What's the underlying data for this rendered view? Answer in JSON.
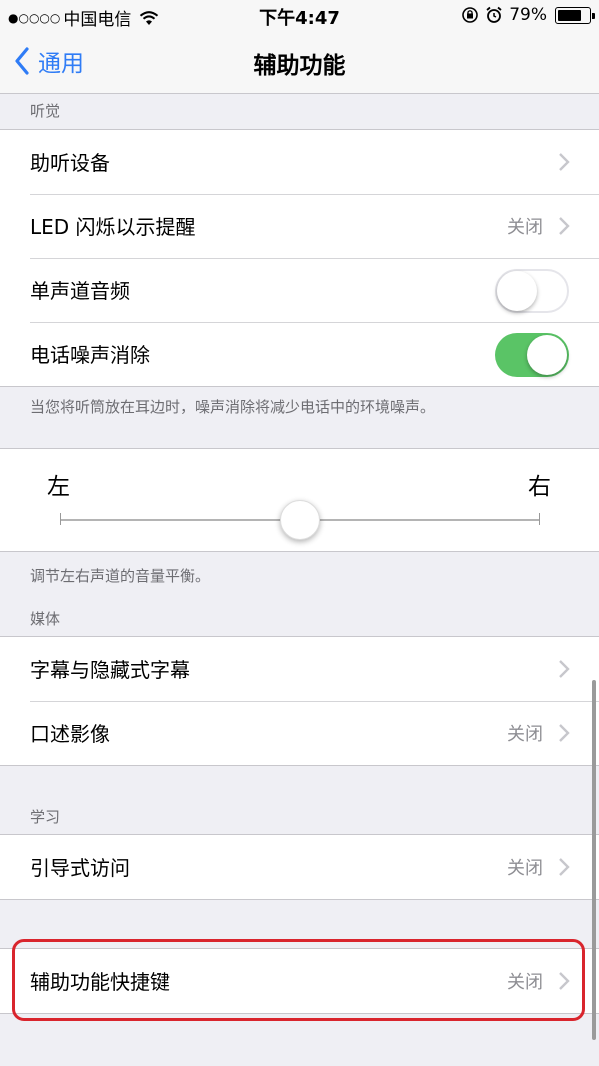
{
  "status_bar": {
    "signal": "●○○○○",
    "carrier": "中国电信",
    "time": "下午4:47",
    "battery_percent": "79%",
    "battery_level": 0.79,
    "icons": [
      "wifi-icon",
      "orientation-lock-icon",
      "alarm-icon",
      "battery-icon"
    ]
  },
  "nav": {
    "back_label": "通用",
    "title": "辅助功能"
  },
  "hearing": {
    "header": "听觉",
    "rows": [
      {
        "label": "助听设备",
        "value": ""
      },
      {
        "label": "LED 闪烁以示提醒",
        "value": "关闭"
      },
      {
        "label": "单声道音频",
        "switch_on": false
      },
      {
        "label": "电话噪声消除",
        "switch_on": true
      }
    ],
    "footer": "当您将听筒放在耳边时，噪声消除将减少电话中的环境噪声。"
  },
  "balance": {
    "left_label": "左",
    "right_label": "右",
    "value": 0.5,
    "footer": "调节左右声道的音量平衡。"
  },
  "media": {
    "header": "媒体",
    "rows": [
      {
        "label": "字幕与隐藏式字幕",
        "value": ""
      },
      {
        "label": "口述影像",
        "value": "关闭"
      }
    ]
  },
  "learning": {
    "header": "学习",
    "rows": [
      {
        "label": "引导式访问",
        "value": "关闭"
      }
    ]
  },
  "shortcut": {
    "rows": [
      {
        "label": "辅助功能快捷键",
        "value": "关闭"
      }
    ]
  },
  "colors": {
    "accent": "#2f7cf6",
    "switch_on": "#5ac466",
    "highlight": "#d9252d",
    "background": "#efeff4"
  }
}
